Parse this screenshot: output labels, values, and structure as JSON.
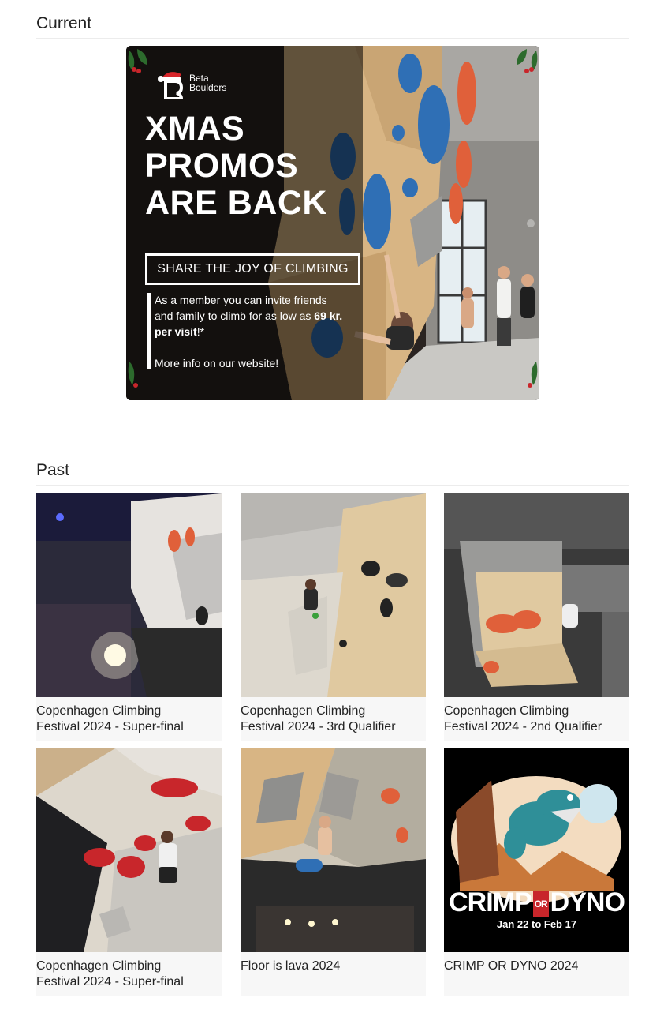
{
  "sections": {
    "current_title": "Current",
    "past_title": "Past"
  },
  "banner": {
    "logo_line1": "Beta",
    "logo_line2": "Boulders",
    "headline_1": "XMAS",
    "headline_2": "PROMOS",
    "headline_3": "ARE BACK",
    "share_label": "SHARE THE JOY OF CLIMBING",
    "info_before": "As a member you can invite friends and family to climb for as low as ",
    "info_price": "69 kr. per visit",
    "info_after": "!*",
    "info_more": "More info on our website!"
  },
  "past_events": [
    {
      "title": "Copenhagen Climbing\nFestival 2024 - Super-final"
    },
    {
      "title": "Copenhagen Climbing\nFestival 2024 - 3rd Qualifier"
    },
    {
      "title": "Copenhagen Climbing\nFestival 2024 -  2nd Qualifier"
    },
    {
      "title": "Copenhagen Climbing\nFestival 2024 - Super-final"
    },
    {
      "title": "Floor is lava 2024"
    },
    {
      "title": "CRIMP OR DYNO 2024"
    }
  ],
  "crimp_logo": {
    "word1": "CRIMP",
    "or": "OR",
    "word2": "DYNO",
    "dates": "Jan 22 to Feb 17"
  },
  "colors": {
    "hold_blue": "#2f6fb5",
    "hold_orange": "#e0603a",
    "hold_red": "#c8262b",
    "wall_plywood": "#d9b98c",
    "wall_grey": "#b9b6b0"
  }
}
